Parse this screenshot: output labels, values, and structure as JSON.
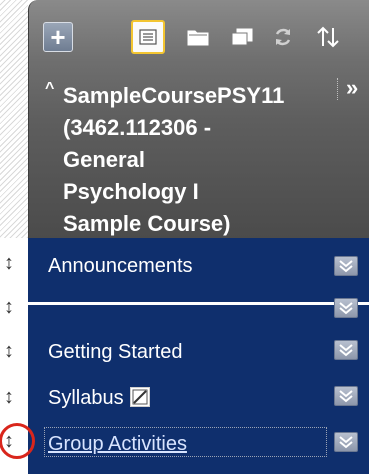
{
  "toolbar": {
    "add_icon": "plus-icon",
    "list_icon": "list-icon",
    "folder_icon": "folder-icon",
    "window_icon": "window-icon",
    "refresh_icon": "refresh-icon",
    "sort_icon": "sort-icon",
    "add_label": "+"
  },
  "course": {
    "title": "SampleCoursePSY11\n(3462.112306 -\nGeneral\nPsychology I\nSample Course)",
    "collapse_label": "^",
    "expand_label": "»"
  },
  "menu": {
    "items": [
      {
        "label": "Announcements"
      },
      {
        "label": ""
      },
      {
        "label": "Getting Started"
      },
      {
        "label": "Syllabus"
      },
      {
        "label": "Group Activities"
      }
    ]
  },
  "colors": {
    "menu_bg": "#0f2f6d",
    "header_bg": "#5e5e5e",
    "highlight": "#d9261c"
  }
}
